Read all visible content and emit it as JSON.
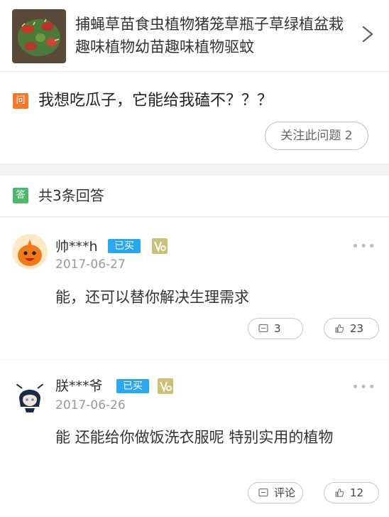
{
  "product": {
    "title": "捕蝇草苗食虫植物猪笼草瓶子草绿植盆栽趣味植物幼苗趣味植物驱蚊",
    "thumb_icon": "venus-flytrap-photo",
    "chevron_icon": "chevron-right-icon"
  },
  "question": {
    "badge": "问",
    "text": "我想吃瓜子，它能给我磕不？？？",
    "follow_label": "关注此问题 2",
    "badge_color": "#f3782b"
  },
  "answers_header": {
    "badge": "答",
    "count_label": "共3条回答",
    "badge_color": "#4cb86b"
  },
  "answers": [
    {
      "username": "帅***h",
      "bought_badge": "已买",
      "vip_icon": "v6-level-badge",
      "date": "2017-06-27",
      "content": "能，还可以替你解决生理需求",
      "comment_label": "3",
      "like_label": "23",
      "avatar_icon": "orange-mascot-avatar"
    },
    {
      "username": "朕***爷",
      "bought_badge": "已买",
      "vip_icon": "v6-level-badge",
      "date": "2017-06-26",
      "content": "能 还能给你做饭洗衣服呢 特别实用的植物",
      "comment_label": "评论",
      "like_label": "12",
      "avatar_icon": "anime-character-avatar"
    }
  ],
  "colors": {
    "bought_badge": "#29a8f0",
    "vip_badge": "#c9c07a"
  }
}
